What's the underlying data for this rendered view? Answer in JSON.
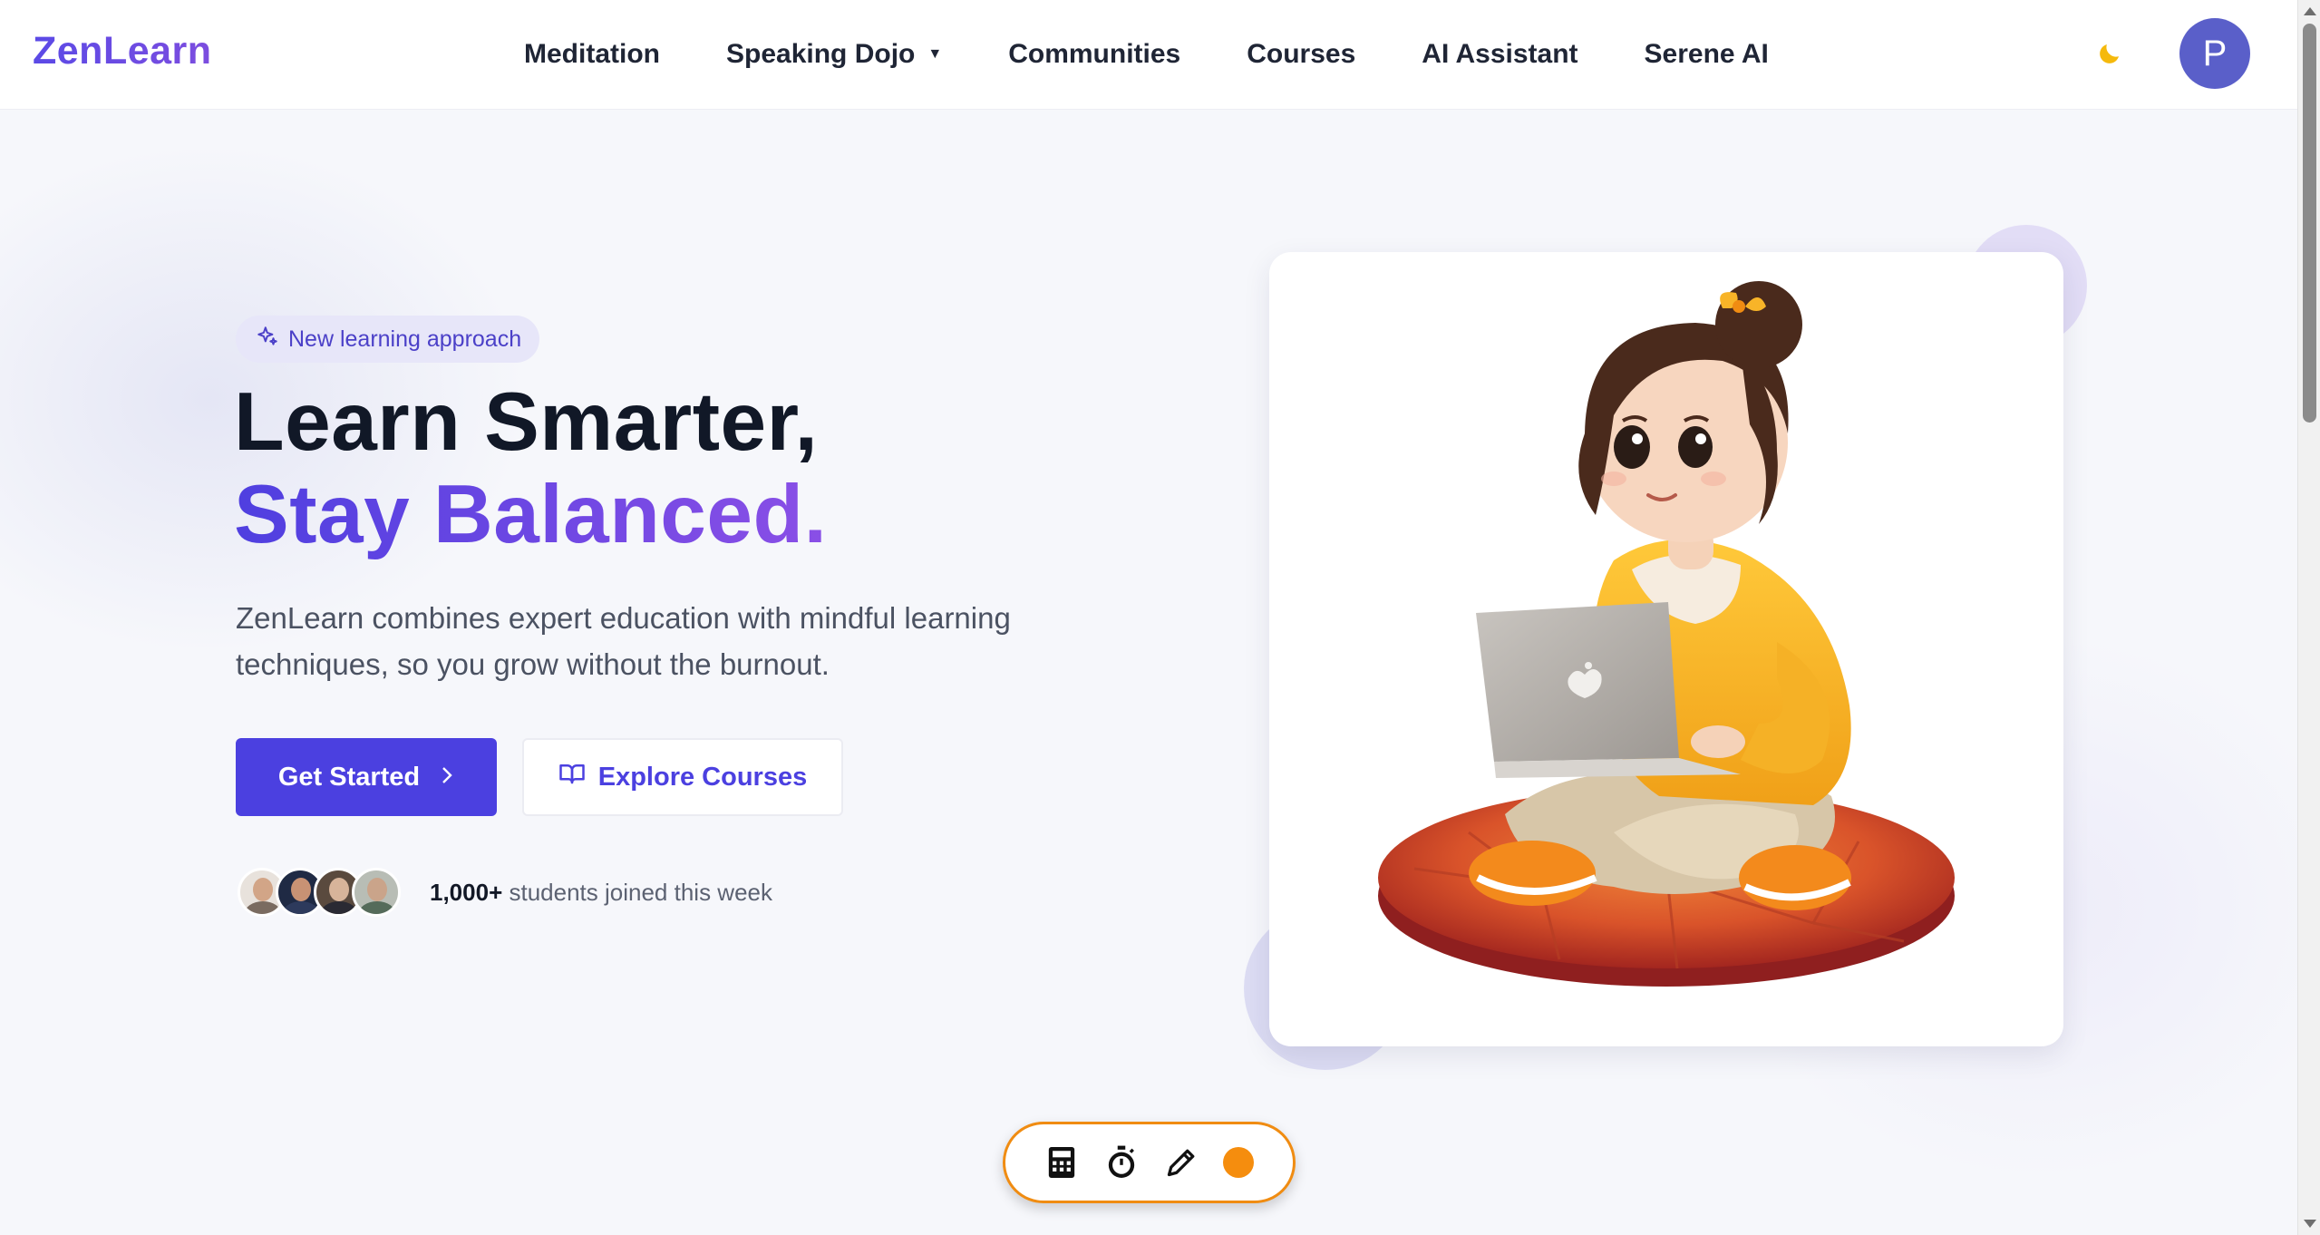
{
  "brand": {
    "name": "ZenLearn"
  },
  "nav": {
    "items": [
      {
        "label": "Meditation",
        "has_dropdown": false
      },
      {
        "label": "Speaking Dojo",
        "has_dropdown": true
      },
      {
        "label": "Communities",
        "has_dropdown": false
      },
      {
        "label": "Courses",
        "has_dropdown": false
      },
      {
        "label": "AI Assistant",
        "has_dropdown": false
      },
      {
        "label": "Serene AI",
        "has_dropdown": false
      }
    ],
    "theme_toggle_icon": "moon-icon",
    "avatar_initial": "P"
  },
  "hero": {
    "badge": "New learning approach",
    "title_line1": "Learn Smarter,",
    "title_line2": "Stay Balanced.",
    "description": "ZenLearn combines expert education with mindful learning techniques, so you grow without the burnout.",
    "primary_cta": "Get Started",
    "secondary_cta": "Explore Courses",
    "students_count": "1,000+",
    "students_text": "students joined this week"
  },
  "toolbar": {
    "tools": [
      "calculator-icon",
      "stopwatch-icon",
      "pencil-icon",
      "status-dot"
    ]
  },
  "colors": {
    "accent": "#4b40e0",
    "brand_gradient_start": "#5b4ae6",
    "brand_gradient_end": "#8a4fe6",
    "toolbar_border": "#f08c12",
    "avatar_bg": "#5a5fc9"
  }
}
